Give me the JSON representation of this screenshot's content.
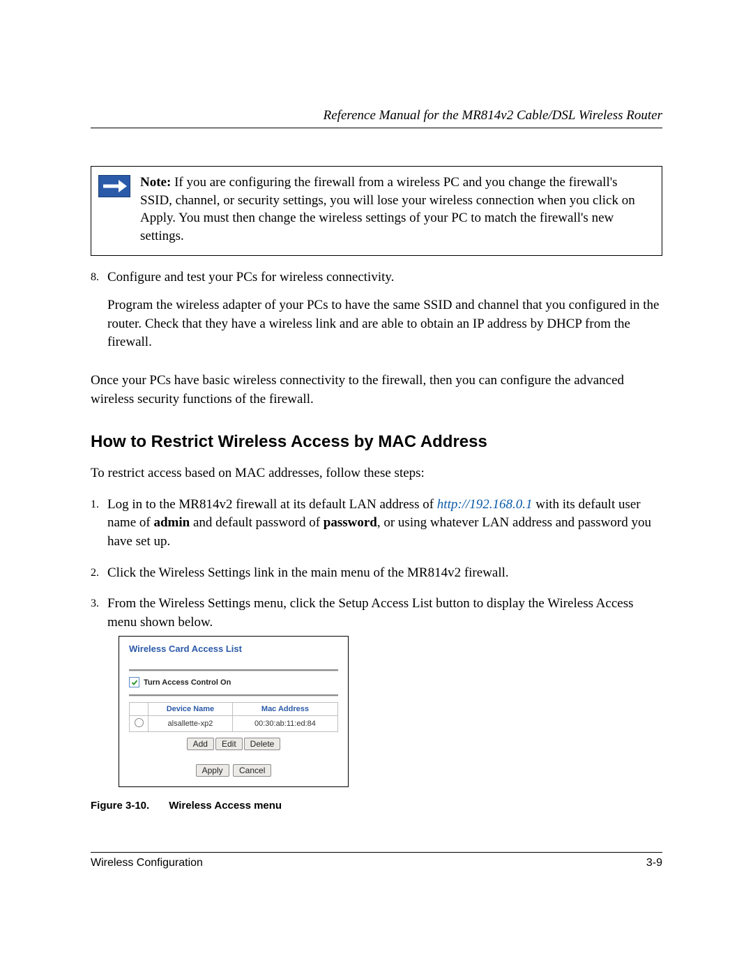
{
  "header": {
    "running": "Reference Manual for the MR814v2 Cable/DSL Wireless Router"
  },
  "note": {
    "label": "Note:",
    "text": " If you are configuring the firewall from a wireless PC and you change the firewall's SSID, channel, or security settings, you will lose your wireless connection when you click on Apply. You must then change the wireless settings of your PC to match the firewall's new settings."
  },
  "step8": {
    "num": "8.",
    "line1": "Configure and test your PCs for wireless connectivity.",
    "line2": "Program the wireless adapter of your PCs to have the same SSID and channel that you configured in the router. Check that they have a wireless link and are able to obtain an IP address by DHCP from the firewall."
  },
  "para_after": "Once your PCs have basic wireless connectivity to the firewall, then you can configure the advanced wireless security functions of the firewall.",
  "section_heading": "How to Restrict Wireless Access by MAC Address",
  "intro": "To restrict access based on MAC addresses, follow these steps:",
  "steps": {
    "s1": {
      "num": "1.",
      "pre": "Log in to the MR814v2 firewall at its default LAN address of ",
      "url": "http://192.168.0.1",
      "mid": " with its default user name of ",
      "b1": "admin",
      "mid2": " and default password of ",
      "b2": "password",
      "post": ", or using whatever LAN address and password you have set up."
    },
    "s2": {
      "num": "2.",
      "text": "Click the Wireless Settings link in the main menu of the MR814v2 firewall."
    },
    "s3": {
      "num": "3.",
      "text": "From the Wireless Settings menu, click the Setup Access List button to display the Wireless Access menu shown below."
    }
  },
  "figure": {
    "title": "Wireless Card Access List",
    "checkbox_label": "Turn Access Control On",
    "th1": "Device Name",
    "th2": "Mac Address",
    "row": {
      "device": "alsallette-xp2",
      "mac": "00:30:ab:11:ed:84"
    },
    "buttons": {
      "add": "Add",
      "edit": "Edit",
      "delete": "Delete",
      "apply": "Apply",
      "cancel": "Cancel"
    },
    "caption_num": "Figure 3-10.",
    "caption_text": "Wireless Access menu"
  },
  "footer": {
    "left": "Wireless Configuration",
    "right": "3-9"
  }
}
